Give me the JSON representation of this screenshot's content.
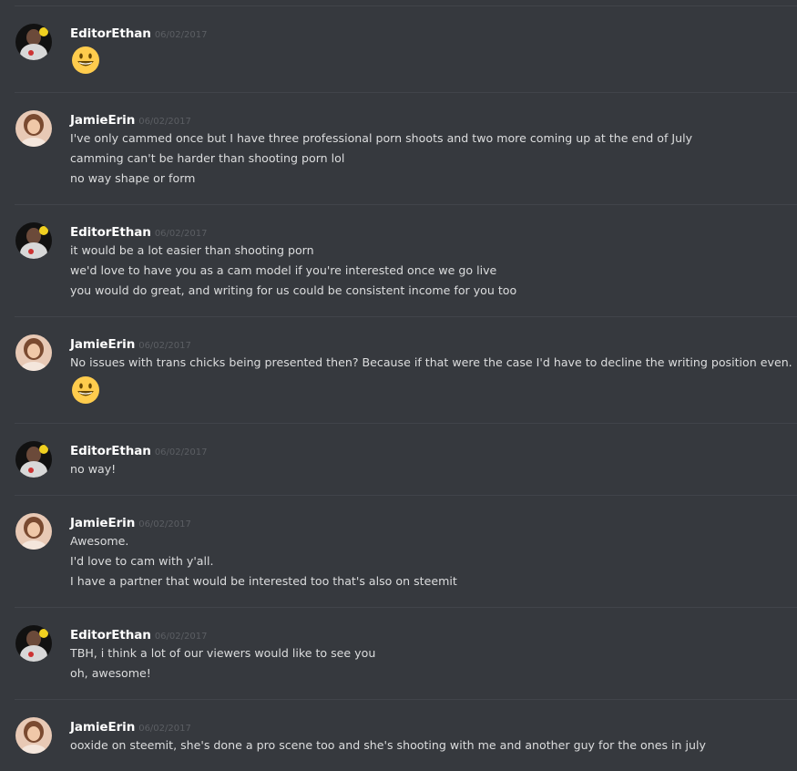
{
  "users": {
    "editor": {
      "name": "EditorEthan"
    },
    "jamie": {
      "name": "JamieErin"
    }
  },
  "messages": [
    {
      "user": "EditorEthan",
      "timestamp": "06/02/2017",
      "lines": [],
      "emoji": "smiley-emoji"
    },
    {
      "user": "JamieErin",
      "timestamp": "06/02/2017",
      "lines": [
        "I've only cammed once but I have three professional porn shoots and two more coming up at the end of July",
        "camming can't be harder than shooting porn lol",
        "no way shape or form"
      ]
    },
    {
      "user": "EditorEthan",
      "timestamp": "06/02/2017",
      "lines": [
        "it would be a lot easier than shooting porn",
        "we'd love to have you as a cam model if you're interested once we go live",
        "you would do great, and writing for us could be consistent income for you too"
      ]
    },
    {
      "user": "JamieErin",
      "timestamp": "06/02/2017",
      "lines": [
        "No issues with trans chicks being presented then? Because if that were the case I'd have to decline the writing position even."
      ],
      "emoji": "smiley-emoji"
    },
    {
      "user": "EditorEthan",
      "timestamp": "06/02/2017",
      "lines": [
        "no way!"
      ]
    },
    {
      "user": "JamieErin",
      "timestamp": "06/02/2017",
      "lines": [
        "Awesome.",
        "I'd love to cam with y'all.",
        "I have a partner that would be interested too that's also on steemit"
      ]
    },
    {
      "user": "EditorEthan",
      "timestamp": "06/02/2017",
      "lines": [
        "TBH, i think a lot of our viewers would like to see you",
        "oh, awesome!"
      ]
    },
    {
      "user": "JamieErin",
      "timestamp": "06/02/2017",
      "lines": [
        "ooxide on steemit, she's done a pro scene too and she's shooting with me and another guy for the ones in july"
      ]
    }
  ],
  "colors": {
    "background": "#36393e",
    "divider": "#41444a",
    "username": "#ffffff",
    "timestamp": "#5b5e63",
    "message_text": "#dcddde",
    "emoji_face": "#ffcc4d"
  }
}
